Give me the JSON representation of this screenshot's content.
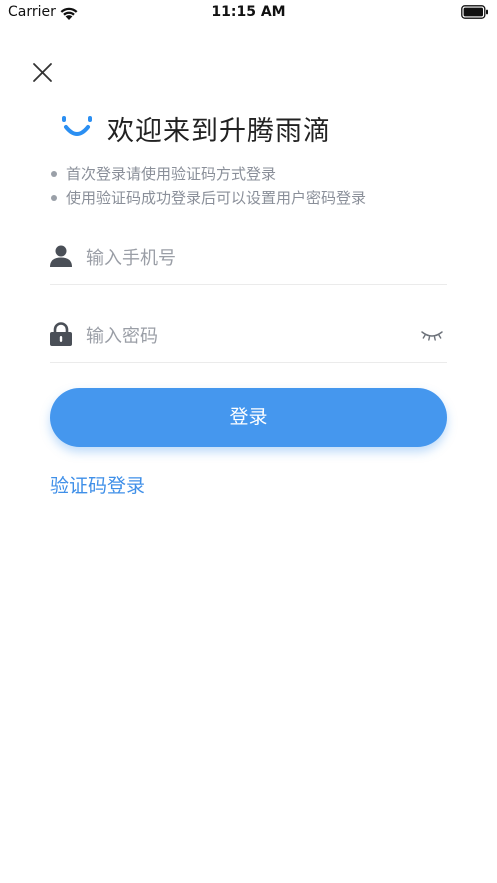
{
  "status_bar": {
    "carrier": "Carrier",
    "time": "11:15 AM"
  },
  "header": {
    "title": "欢迎来到升腾雨滴",
    "logo_color": "#2b8ff2"
  },
  "tips": [
    "首次登录请使用验证码方式登录",
    "使用验证码成功登录后可以设置用户密码登录"
  ],
  "form": {
    "phone_placeholder": "输入手机号",
    "password_placeholder": "输入密码",
    "phone_icon": "user-icon",
    "password_icon": "lock-icon",
    "visibility_icon": "eye-closed-icon"
  },
  "actions": {
    "login_label": "登录",
    "alt_login_label": "验证码登录"
  },
  "colors": {
    "accent": "#4597ee",
    "link": "#3f8fe8",
    "tip_text": "#8a8f99",
    "icon": "#4a4f57"
  }
}
